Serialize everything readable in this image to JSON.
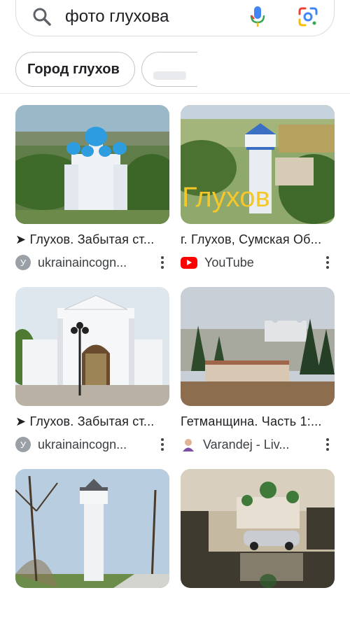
{
  "search": {
    "query": "фото глухова"
  },
  "chips": [
    {
      "label": "Город глухов"
    }
  ],
  "results": [
    {
      "title": "➤ Глухов. Забытая ст...",
      "source": "ukrainaincogn...",
      "source_icon": "ukrainaincognita-icon"
    },
    {
      "title": "г. Глухов, Сумская Об...",
      "source": "YouTube",
      "source_icon": "youtube-icon",
      "overlay_text": "Глухов"
    },
    {
      "title": "➤ Глухов. Забытая ст...",
      "source": "ukrainaincogn...",
      "source_icon": "ukrainaincognita-icon"
    },
    {
      "title": "Гетманщина. Часть 1:...",
      "source": "Varandej - Liv...",
      "source_icon": "user-avatar-icon"
    },
    {
      "title": "",
      "source": "",
      "source_icon": ""
    },
    {
      "title": "",
      "source": "",
      "source_icon": ""
    }
  ],
  "colors": {
    "youtube_red": "#ff0000",
    "google_blue": "#4285f4",
    "google_red": "#ea4335",
    "google_yellow": "#fbbc04",
    "google_green": "#34a853"
  }
}
